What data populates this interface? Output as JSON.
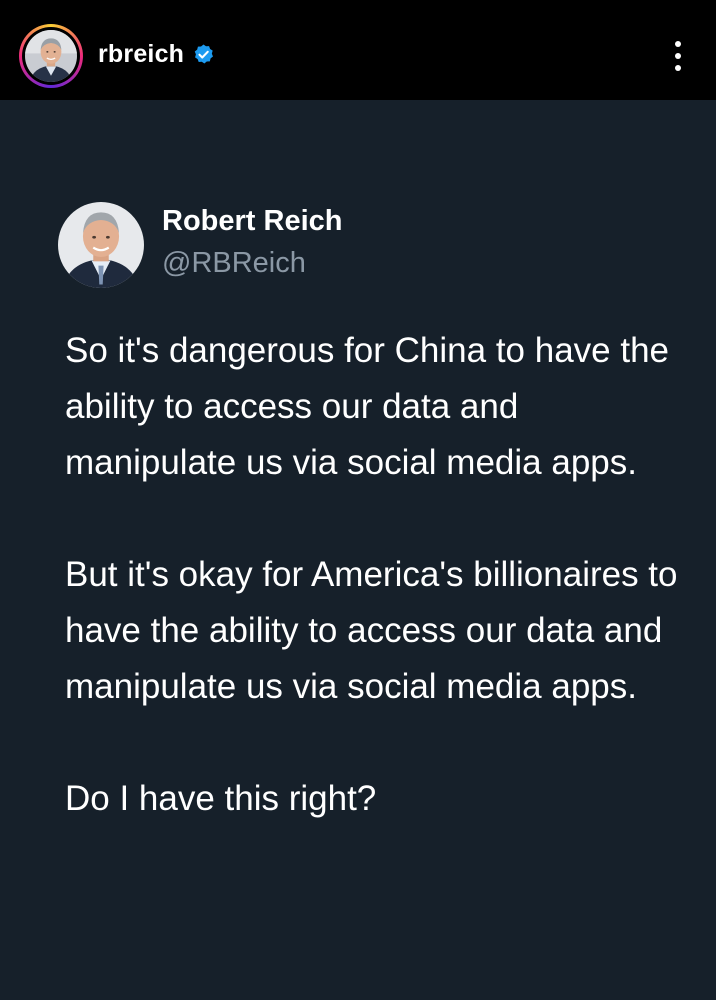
{
  "header": {
    "username": "rbreich",
    "verified_icon": "verified-badge-icon",
    "menu_icon": "more-vertical-icon"
  },
  "tweet": {
    "display_name": "Robert Reich",
    "handle": "@RBReich",
    "paragraphs": [
      "So it's dangerous for China to have the ability to access our data and manipulate us via social media apps.",
      "But it's okay for America's billionaires to have the ability to access our data and manipulate us via social media apps.",
      "Do I have this right?"
    ]
  },
  "colors": {
    "header_bg": "#000000",
    "card_bg": "#16202a",
    "text_primary": "#ffffff",
    "text_secondary": "#8b98a5",
    "verified": "#1d9bf0"
  }
}
